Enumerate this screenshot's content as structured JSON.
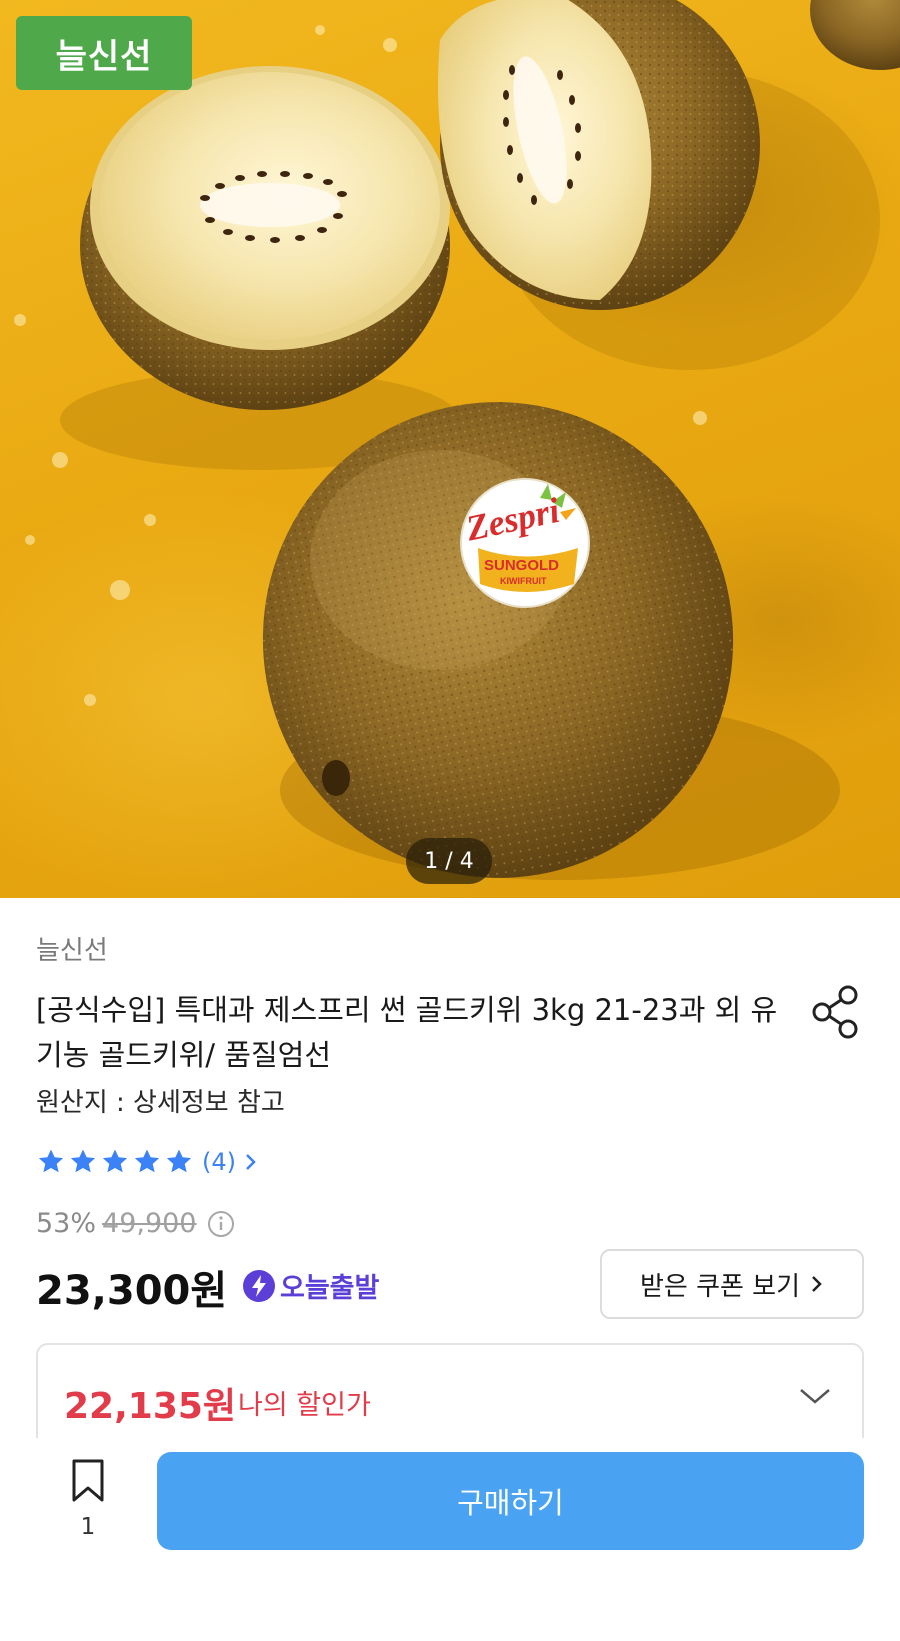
{
  "hero": {
    "store_tag": "늘신선",
    "page_current": "1",
    "page_total": "4",
    "page_indicator": "1 / 4",
    "sticker": {
      "brand": "Zespri",
      "line1": "SUNGOLD",
      "line2": "KIWIFRUIT"
    }
  },
  "product": {
    "seller": "늘신선",
    "title": "[공식수입] 특대과 제스프리 썬 골드키위 3kg 21-23과 외 유기농 골드키위/ 품질엄선",
    "origin": "원산지 : 상세정보 참고",
    "rating": {
      "stars": 5,
      "review_count": "(4)"
    },
    "discount_rate": "53%",
    "original_price": "49,900",
    "price": "23,300원",
    "delivery_badge": "오늘출발",
    "coupon_button": "받은 쿠폰 보기",
    "my_price": {
      "amount": "22,135원",
      "label": "나의 할인가"
    }
  },
  "bottom_bar": {
    "wish_count": "1",
    "buy_button": "구매하기"
  },
  "colors": {
    "accent_blue": "#4aa3f2",
    "star_blue": "#3b82f6",
    "discount_red": "#e23b4a",
    "delivery_purple": "#5b3fd6",
    "store_tag_green": "#4fa84a"
  }
}
